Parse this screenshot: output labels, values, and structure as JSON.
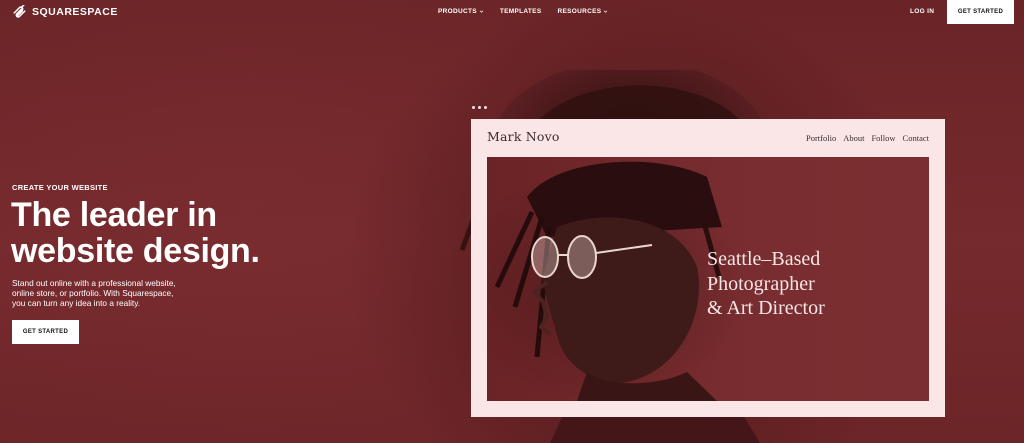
{
  "nav": {
    "logo_text": "SQUARESPACE",
    "links": [
      {
        "label": "PRODUCTS",
        "dropdown": true
      },
      {
        "label": "TEMPLATES",
        "dropdown": false
      },
      {
        "label": "RESOURCES",
        "dropdown": true
      }
    ],
    "login": "LOG IN",
    "cta": "GET STARTED"
  },
  "hero": {
    "eyebrow": "CREATE YOUR WEBSITE",
    "headline_line1": "The leader in",
    "headline_line2": "website design.",
    "body_line1": "Stand out online with a professional website,",
    "body_line2": "online store, or portfolio. With Squarespace,",
    "body_line3": "you can turn any idea into a reality.",
    "cta": "GET STARTED"
  },
  "preview": {
    "brand": "Mark Novo",
    "nav": [
      "Portfolio",
      "About",
      "Follow",
      "Contact"
    ],
    "heading_line1": "Seattle–Based",
    "heading_line2": "Photographer",
    "heading_line3": "& Art Director"
  },
  "colors": {
    "background": "#6e2629",
    "card": "#fbe6e7",
    "cta_bg": "#ffffff",
    "cta_text": "#111111"
  },
  "icons": [
    "squarespace-logo-icon",
    "chevron-down-icon",
    "more-dots-icon"
  ]
}
